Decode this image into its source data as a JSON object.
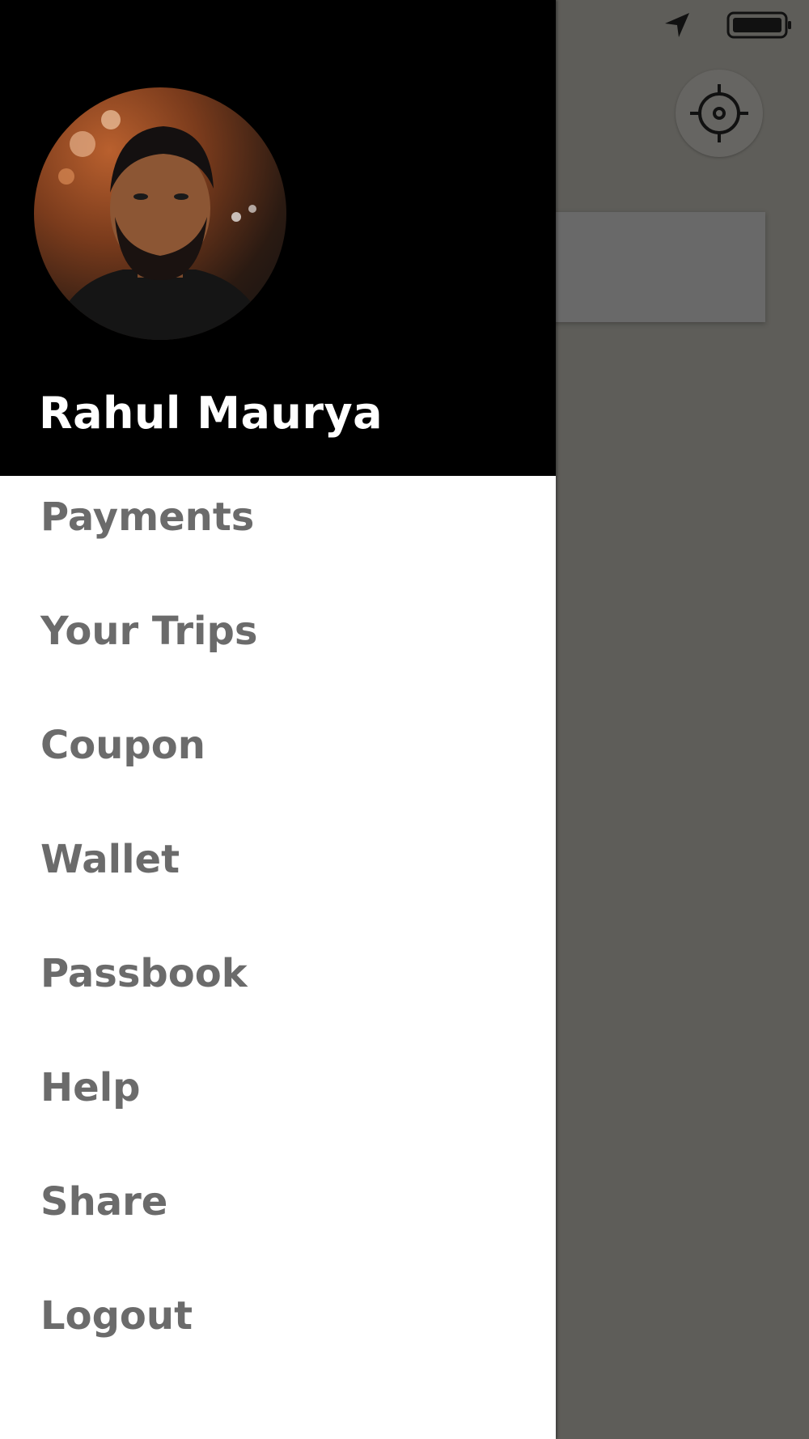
{
  "user": {
    "name": "Rahul Maurya"
  },
  "menu": {
    "items": [
      {
        "label": "Payments"
      },
      {
        "label": "Your Trips"
      },
      {
        "label": "Coupon"
      },
      {
        "label": "Wallet"
      },
      {
        "label": "Passbook"
      },
      {
        "label": "Help"
      },
      {
        "label": "Share"
      },
      {
        "label": "Logout"
      }
    ]
  },
  "icons": {
    "location": "location-arrow-icon",
    "battery": "battery-icon",
    "locate": "crosshair-icon"
  },
  "colors": {
    "drawer_header": "#000000",
    "drawer_body": "#ffffff",
    "menu_text": "#6b6b6b",
    "overlay": "#5e5d59"
  }
}
